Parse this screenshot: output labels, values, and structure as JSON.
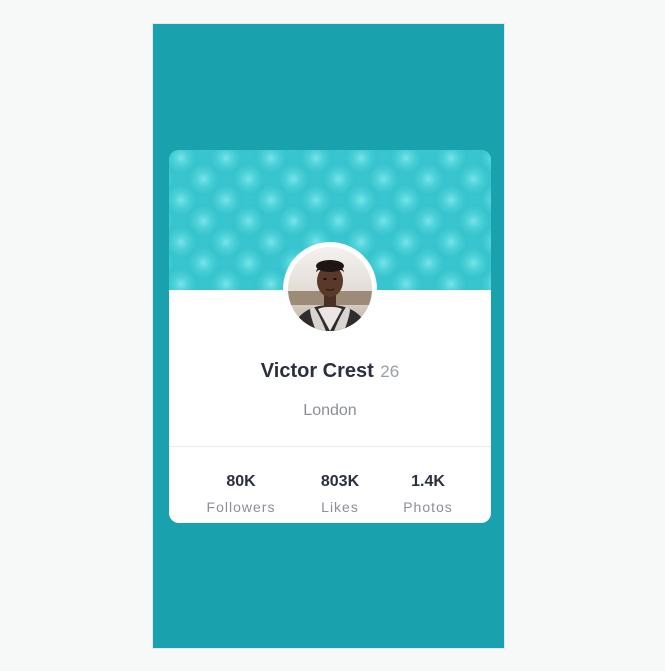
{
  "profile": {
    "name": "Victor Crest",
    "age": "26",
    "location": "London",
    "avatar": "avatar-photo"
  },
  "stats": [
    {
      "value": "80K",
      "label": "Followers"
    },
    {
      "value": "803K",
      "label": "Likes"
    },
    {
      "value": "1.4K",
      "label": "Photos"
    }
  ],
  "colors": {
    "background": "#19a1ae",
    "banner": "#3cc9d2",
    "card": "#ffffff",
    "heading": "#2b2f3f",
    "muted": "#8b8f95"
  }
}
